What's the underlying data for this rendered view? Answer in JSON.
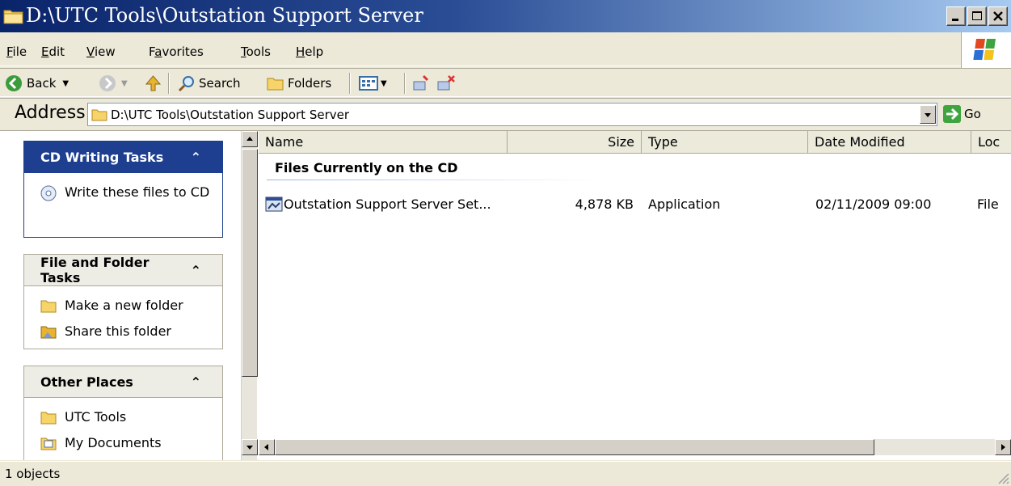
{
  "window": {
    "title": "D:\\UTC Tools\\Outstation Support Server"
  },
  "menu": [
    {
      "u": "F",
      "rest": "ile"
    },
    {
      "u": "E",
      "rest": "dit"
    },
    {
      "u": "V",
      "rest": "iew"
    },
    {
      "pre": "F",
      "u": "a",
      "rest": "vorites"
    },
    {
      "u": "T",
      "rest": "ools"
    },
    {
      "u": "H",
      "rest": "elp"
    }
  ],
  "toolbar": {
    "back": "Back",
    "search": "Search",
    "folders": "Folders"
  },
  "address": {
    "label": "Address",
    "path": "D:\\UTC Tools\\Outstation Support Server",
    "go": "Go"
  },
  "tasks": {
    "cd": {
      "title": "CD Writing Tasks",
      "items": [
        "Write these files to CD"
      ]
    },
    "file": {
      "title": "File and Folder Tasks",
      "items": [
        "Make a new folder",
        "Share this folder"
      ]
    },
    "other": {
      "title": "Other Places",
      "items": [
        "UTC Tools",
        "My Documents"
      ]
    }
  },
  "columns": {
    "name": "Name",
    "size": "Size",
    "type": "Type",
    "date": "Date Modified",
    "loc": "Loc"
  },
  "group": "Files Currently on the CD",
  "files": [
    {
      "name": "Outstation Support Server Set...",
      "size": "4,878 KB",
      "type": "Application",
      "date": "02/11/2009 09:00",
      "loc": "File"
    }
  ],
  "status": "1 objects"
}
